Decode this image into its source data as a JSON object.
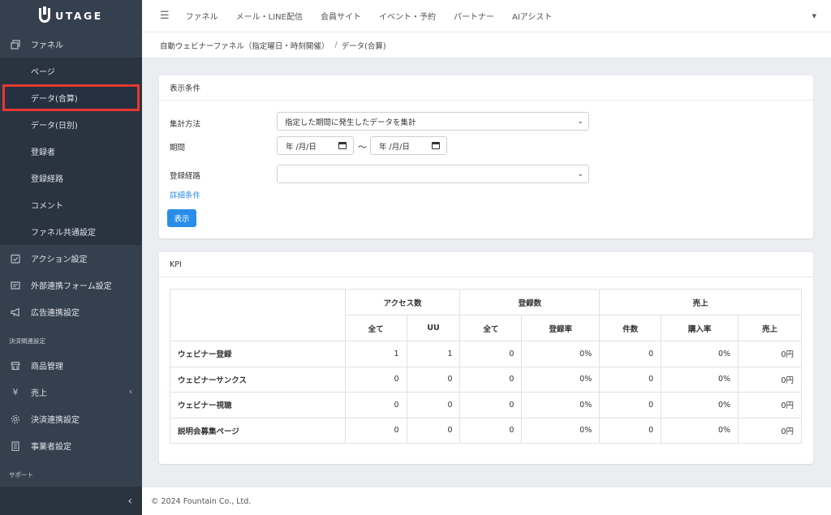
{
  "brand": {
    "name": "UTAGE"
  },
  "sidebar": {
    "items": [
      {
        "label": "ファネル",
        "icon": "funnel-icon"
      },
      {
        "label": "ページ"
      },
      {
        "label": "データ(合算)"
      },
      {
        "label": "データ(日別)"
      },
      {
        "label": "登録者"
      },
      {
        "label": "登録経路"
      },
      {
        "label": "コメント"
      },
      {
        "label": "ファネル共通設定"
      },
      {
        "label": "アクション設定",
        "icon": "checklist-icon"
      },
      {
        "label": "外部連携フォーム設定",
        "icon": "form-icon"
      },
      {
        "label": "広告連携設定",
        "icon": "megaphone-icon"
      }
    ],
    "payment_section": "決済関連設定",
    "payment_items": [
      {
        "label": "商品管理",
        "icon": "shop-icon"
      },
      {
        "label": "売上",
        "icon": "yen-icon",
        "icon_glyph": "¥"
      },
      {
        "label": "決済連携設定",
        "icon": "gear-icon"
      },
      {
        "label": "事業者設定",
        "icon": "building-icon"
      }
    ],
    "support_section": "サポート"
  },
  "topbar": {
    "nav": [
      "ファネル",
      "メール・LINE配信",
      "会員サイト",
      "イベント・予約",
      "パートナー",
      "AIアシスト"
    ]
  },
  "breadcrumb": {
    "parent": "自動ウェビナーファネル（指定曜日・時刻開催）",
    "separator": "/",
    "current": "データ(合算)"
  },
  "conditions": {
    "title": "表示条件",
    "method_label": "集計方法",
    "method_value": "指定した期間に発生したデータを集計",
    "period_label": "期間",
    "date_from": "年 /月/日",
    "date_to": "年 /月/日",
    "tilde": "〜",
    "route_label": "登録経路",
    "route_value": "",
    "detail_link": "詳細条件",
    "submit": "表示"
  },
  "kpi": {
    "title": "KPI",
    "groups": [
      "アクセス数",
      "登録数",
      "売上"
    ],
    "columns": [
      "全て",
      "UU",
      "全て",
      "登録率",
      "件数",
      "購入率",
      "売上"
    ],
    "rows": [
      {
        "label": "ウェビナー登録",
        "values": [
          "1",
          "1",
          "0",
          "0%",
          "0",
          "0%",
          "0円"
        ]
      },
      {
        "label": "ウェビナーサンクス",
        "values": [
          "0",
          "0",
          "0",
          "0%",
          "0",
          "0%",
          "0円"
        ]
      },
      {
        "label": "ウェビナー視聴",
        "values": [
          "0",
          "0",
          "0",
          "0%",
          "0",
          "0%",
          "0円"
        ]
      },
      {
        "label": "説明会募集ページ",
        "values": [
          "0",
          "0",
          "0",
          "0%",
          "0",
          "0%",
          "0円"
        ]
      }
    ]
  },
  "footer": {
    "copyright": "© 2024 Fountain Co., Ltd."
  },
  "colors": {
    "sidebar": "#35404f",
    "accent": "#2a8ee8",
    "highlight": "#e8382e"
  }
}
